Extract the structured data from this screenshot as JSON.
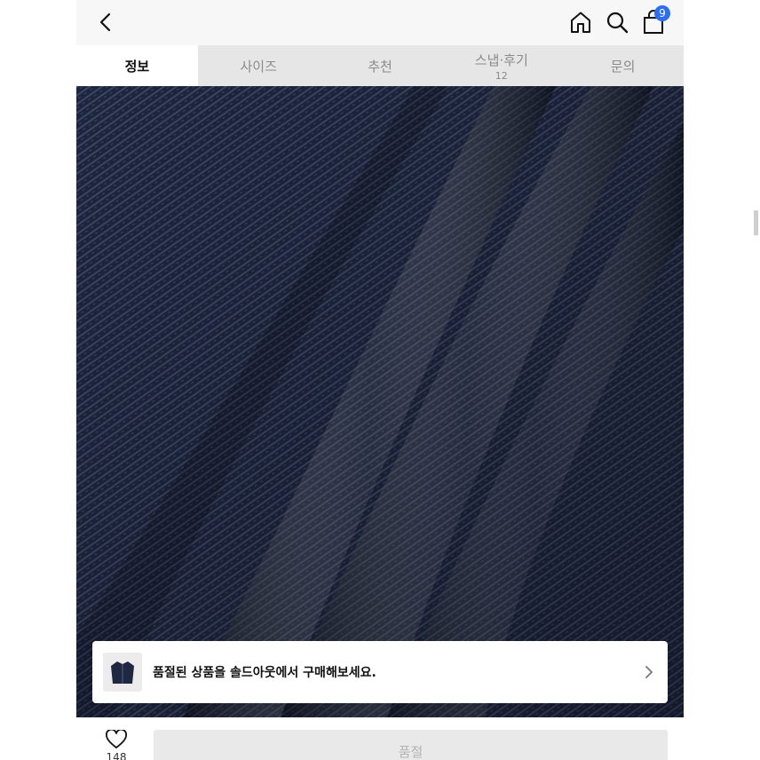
{
  "header": {
    "back_icon": "chevron-left-icon",
    "home_icon": "home-icon",
    "search_icon": "search-icon",
    "cart_icon": "shopping-bag-icon",
    "cart_count": "9"
  },
  "tabs": [
    {
      "label": "정보",
      "active": true
    },
    {
      "label": "사이즈"
    },
    {
      "label": "추천"
    },
    {
      "label": "스냅·후기",
      "count": "12"
    },
    {
      "label": "문의"
    }
  ],
  "banner": {
    "text": "품절된 상품을 솔드아웃에서 구매해보세요.",
    "thumb_icon": "jacket-thumbnail"
  },
  "bottom": {
    "like_icon": "heart-icon",
    "like_count": "148",
    "buy_label": "품절"
  },
  "colors": {
    "accent_badge": "#2b6df5",
    "denim": "#1e2740",
    "tab_bg": "#e6e6e6"
  }
}
